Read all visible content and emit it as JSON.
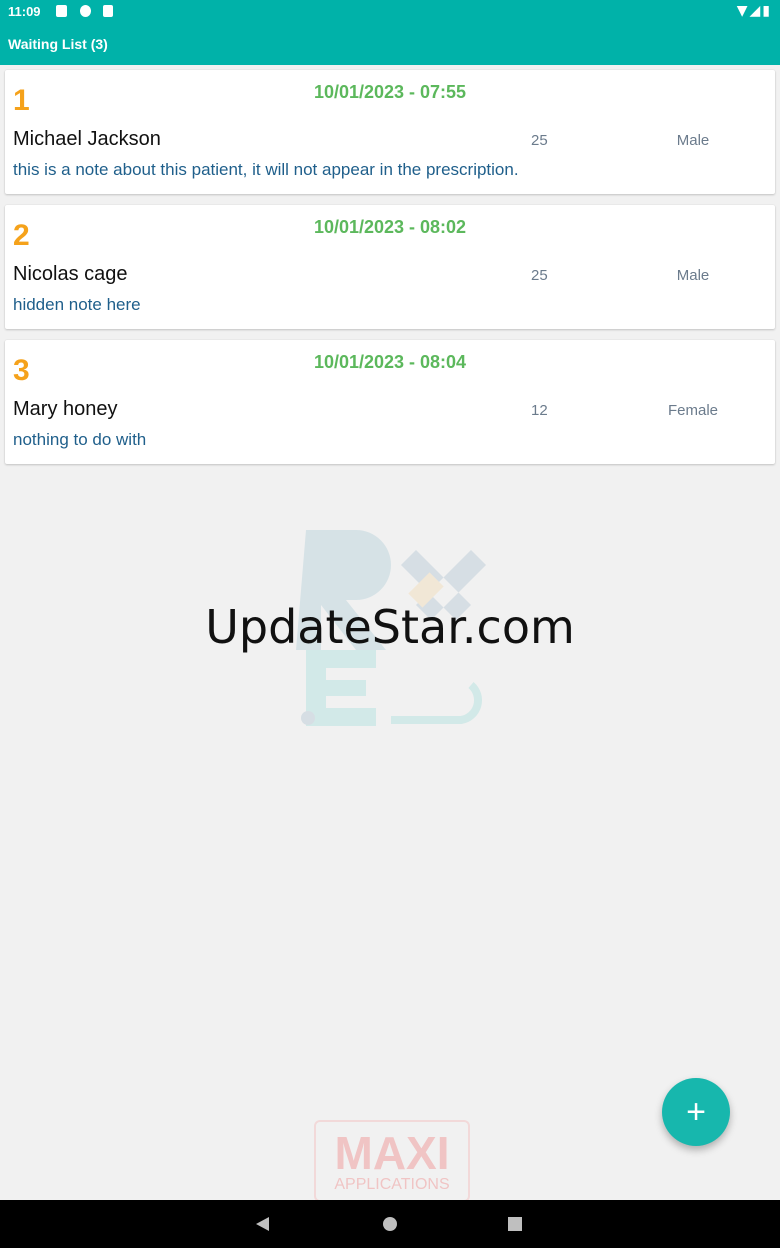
{
  "status_bar": {
    "time": "11:09"
  },
  "app_bar": {
    "title": "Waiting List  (3)"
  },
  "patients": [
    {
      "number": "1",
      "datetime": "10/01/2023 - 07:55",
      "name": "Michael Jackson",
      "age": "25",
      "gender": "Male",
      "note": "this is a note about this patient, it will not appear in the prescription."
    },
    {
      "number": "2",
      "datetime": "10/01/2023 - 08:02",
      "name": "Nicolas cage",
      "age": "25",
      "gender": "Male",
      "note": "hidden note here"
    },
    {
      "number": "3",
      "datetime": "10/01/2023 - 08:04",
      "name": "Mary honey",
      "age": "12",
      "gender": "Female",
      "note": "nothing to do with"
    }
  ],
  "watermark": "UpdateStar.com",
  "footer_logo": {
    "title": "MAXI",
    "subtitle": "APPLICATIONS"
  },
  "colors": {
    "accent": "#00b2a9",
    "number": "#f5a21b",
    "date": "#5cb85c",
    "note": "#1f5f8b"
  }
}
